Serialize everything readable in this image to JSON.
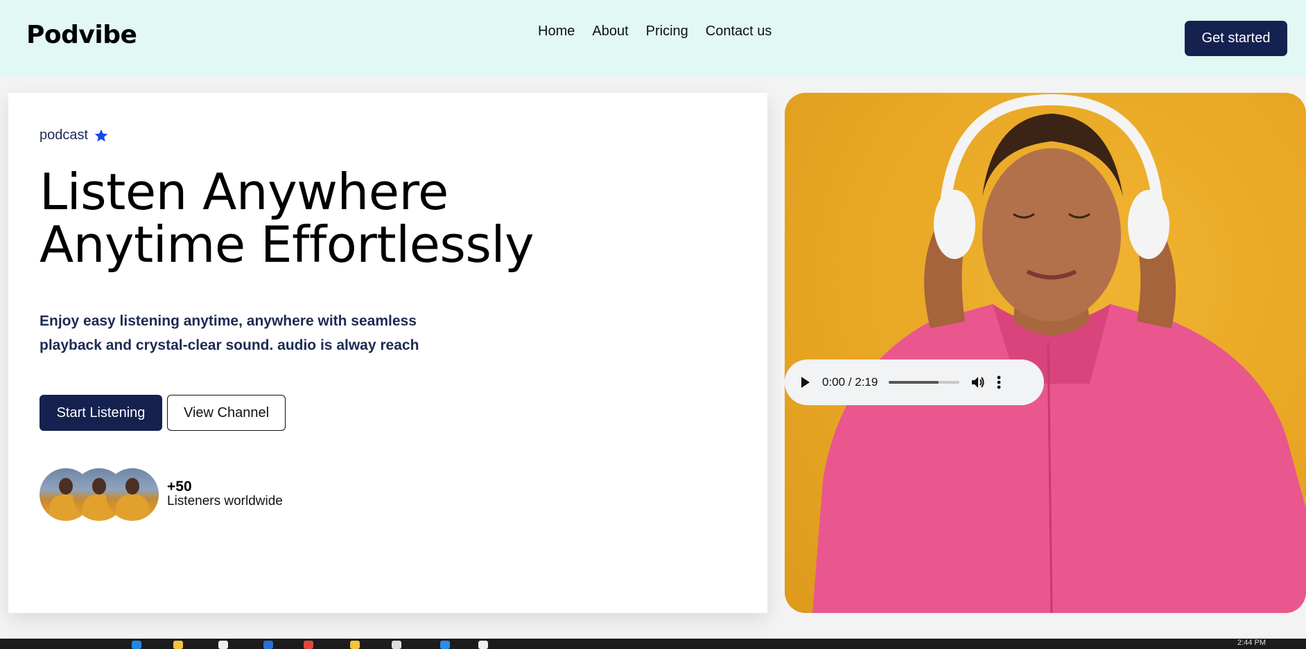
{
  "navbar": {
    "brand": "Podvibe",
    "links": [
      "Home",
      "About",
      "Pricing",
      "Contact us"
    ],
    "cta": "Get started"
  },
  "hero": {
    "eyebrow": "podcast",
    "eyebrow_icon": "star-icon",
    "headline_line1": "Listen Anywhere",
    "headline_line2": "Anytime Effortlessly",
    "subtext_line1": "Enjoy easy listening anytime, anywhere with seamless",
    "subtext_line2": "playback and crystal-clear sound. audio is alway reach",
    "primary_button": "Start Listening",
    "secondary_button": "View Channel",
    "listener_count": "+50",
    "listener_label": "Listeners worldwide"
  },
  "audio_player": {
    "time": "0:00 / 2:19",
    "progress": 0.7,
    "icons": [
      "play-icon",
      "volume-icon",
      "more-icon"
    ]
  },
  "taskbar": {
    "clock": "2:44 PM"
  },
  "colors": {
    "navbar_bg": "#e1f8f5",
    "primary": "#15214f",
    "photo_bg": "#e8a624",
    "star": "#1347e8"
  }
}
